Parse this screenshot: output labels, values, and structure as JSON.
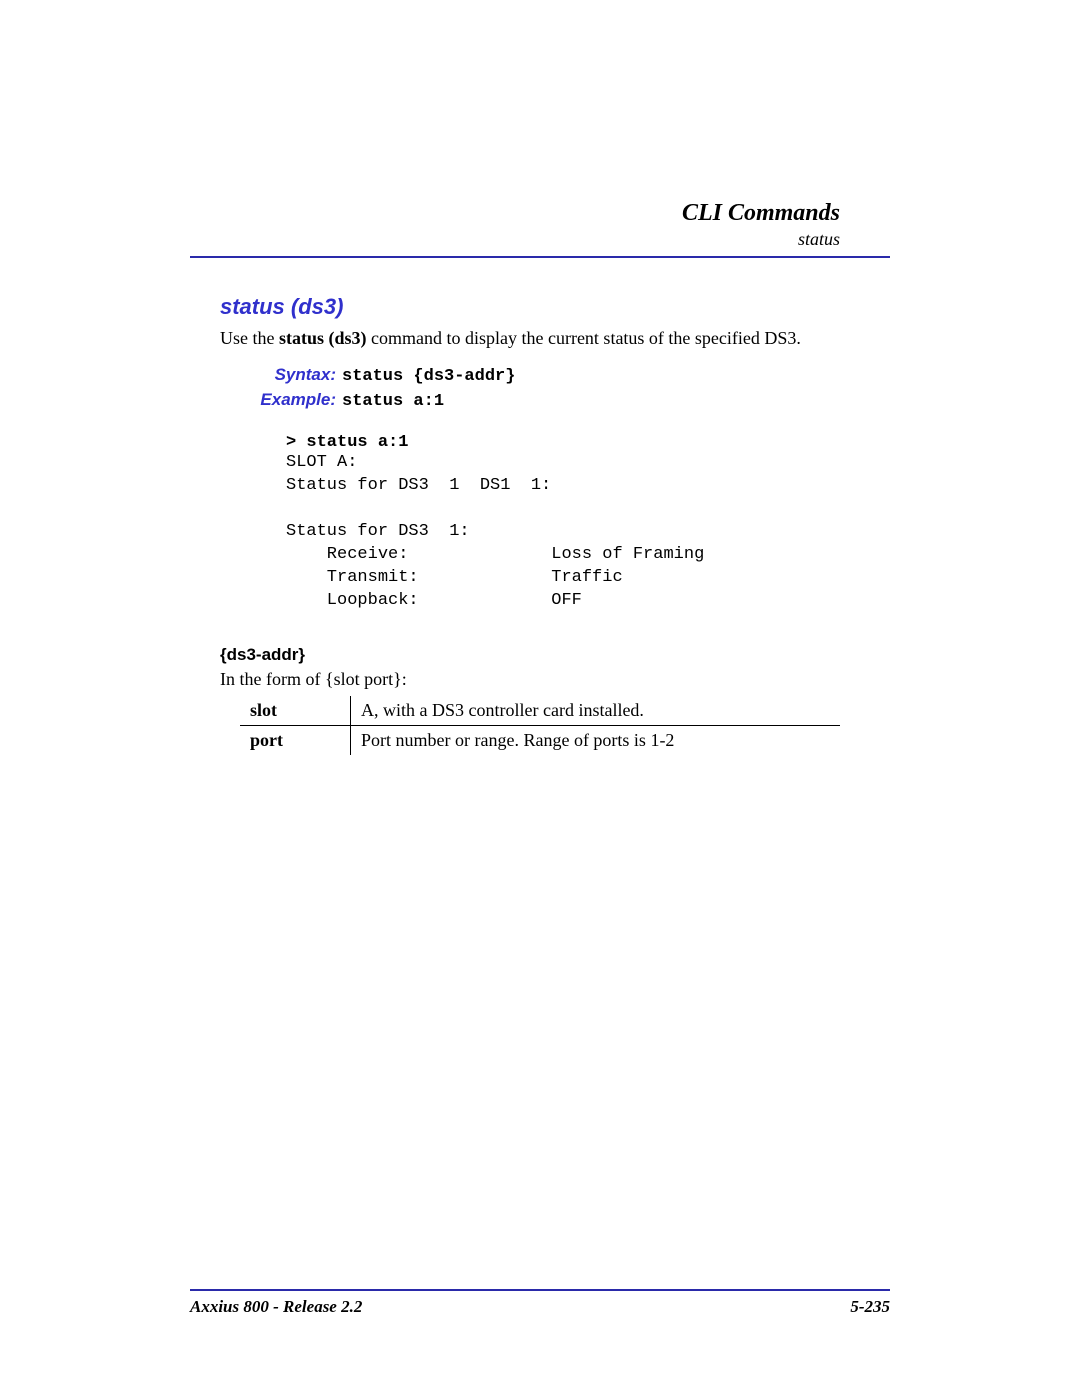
{
  "header": {
    "title": "CLI Commands",
    "subtitle": "status"
  },
  "section": {
    "title": "status (ds3)",
    "desc_prefix": "Use the ",
    "desc_bold": "status (ds3)",
    "desc_suffix": " command to display the current status of the specified DS3."
  },
  "syntax": {
    "label": "Syntax:",
    "text": "status {ds3-addr}"
  },
  "example": {
    "label": "Example:",
    "text": "status a:1"
  },
  "output": {
    "prompt": "> status a:1",
    "body": "SLOT A:\nStatus for DS3  1  DS1  1:\n\nStatus for DS3  1:\n    Receive:              Loss of Framing\n    Transmit:             Traffic\n    Loopback:             OFF"
  },
  "param": {
    "heading": "{ds3-addr}",
    "desc": "In the form of {slot port}:",
    "rows": [
      {
        "term": "slot",
        "def": "A, with a DS3 controller card installed."
      },
      {
        "term": "port",
        "def": "Port number or range. Range of ports is 1-2"
      }
    ]
  },
  "footer": {
    "left": "Axxius 800 - Release 2.2",
    "right": "5-235"
  }
}
